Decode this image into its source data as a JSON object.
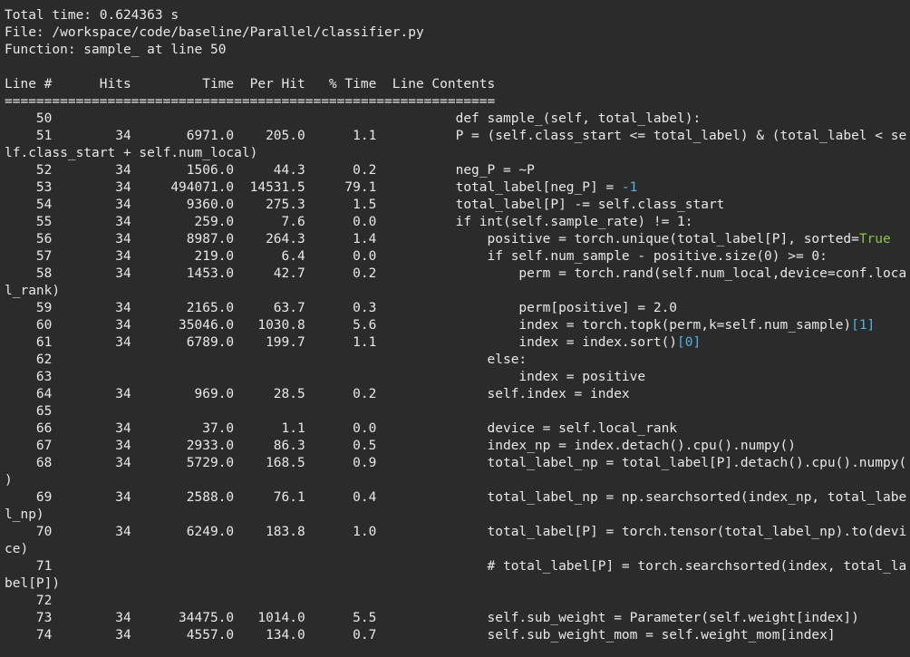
{
  "header": {
    "total_time": "Total time: 0.624363 s",
    "file": "File: /workspace/code/baseline/Parallel/classifier.py",
    "function": "Function: sample_ at line 50"
  },
  "table": {
    "header_row": "Line #      Hits         Time  Per Hit   % Time  Line Contents",
    "separator": "==============================================================",
    "rows": [
      [
        {
          "t": "    50                                                   def sample_(self, total_label):"
        }
      ],
      [
        {
          "t": "    51        34       6971.0    205.0      1.1          P = (self.class_start <= total_label) & (total_label < se"
        }
      ],
      [
        {
          "t": "lf.class_start + self.num_local)"
        }
      ],
      [
        {
          "t": "    52        34       1506.0     44.3      0.2          neg_P = ~P"
        }
      ],
      [
        {
          "t": "    53        34     494071.0  14531.5     79.1          total_label[neg_P] = "
        },
        {
          "t": "-1",
          "c": "num"
        }
      ],
      [
        {
          "t": "    54        34       9360.0    275.3      1.5          total_label[P] -= self.class_start"
        }
      ],
      [
        {
          "t": "    55        34        259.0      7.6      0.0          if int(self.sample_rate) != 1:"
        }
      ],
      [
        {
          "t": "    56        34       8987.0    264.3      1.4              positive = torch.unique(total_label[P], sorted="
        },
        {
          "t": "True",
          "c": "bool"
        }
      ],
      [
        {
          "t": "    57        34        219.0      6.4      0.0              if self.num_sample - positive.size(0) >= 0:"
        }
      ],
      [
        {
          "t": "    58        34       1453.0     42.7      0.2                  perm = torch.rand(self.num_local,device=conf.loca"
        }
      ],
      [
        {
          "t": "l_rank)"
        }
      ],
      [
        {
          "t": "    59        34       2165.0     63.7      0.3                  perm[positive] = 2.0"
        }
      ],
      [
        {
          "t": "    60        34      35046.0   1030.8      5.6                  index = torch.topk(perm,k=self.num_sample)"
        },
        {
          "t": "[1]",
          "c": "num"
        }
      ],
      [
        {
          "t": "    61        34       6789.0    199.7      1.1                  index = index.sort()"
        },
        {
          "t": "[0]",
          "c": "num"
        }
      ],
      [
        {
          "t": "    62                                                       else:"
        }
      ],
      [
        {
          "t": "    63                                                           index = positive"
        }
      ],
      [
        {
          "t": "    64        34        969.0     28.5      0.2              self.index = index"
        }
      ],
      [
        {
          "t": "    65"
        }
      ],
      [
        {
          "t": "    66        34         37.0      1.1      0.0              device = self.local_rank"
        }
      ],
      [
        {
          "t": "    67        34       2933.0     86.3      0.5              index_np = index.detach().cpu().numpy()"
        }
      ],
      [
        {
          "t": "    68        34       5729.0    168.5      0.9              total_label_np = total_label[P].detach().cpu().numpy("
        }
      ],
      [
        {
          "t": ")"
        }
      ],
      [
        {
          "t": "    69        34       2588.0     76.1      0.4              total_label_np = np.searchsorted(index_np, total_labe"
        }
      ],
      [
        {
          "t": "l_np)"
        }
      ],
      [
        {
          "t": "    70        34       6249.0    183.8      1.0              total_label[P] = torch.tensor(total_label_np).to(devi"
        }
      ],
      [
        {
          "t": "ce)"
        }
      ],
      [
        {
          "t": "    71                                                       # total_label[P] = torch.searchsorted(index, total_la"
        }
      ],
      [
        {
          "t": "bel[P])"
        }
      ],
      [
        {
          "t": "    72"
        }
      ],
      [
        {
          "t": "    73        34      34475.0   1014.0      5.5              self.sub_weight = Parameter(self.weight[index])"
        }
      ],
      [
        {
          "t": "    74        34       4557.0    134.0      0.7              self.sub_weight_mom = self.weight_mom[index]"
        }
      ]
    ]
  },
  "colors": {
    "background": "#2b2b2b",
    "text": "#e8e8e8",
    "number": "#4fb3e8",
    "boolean": "#8bc34a"
  }
}
